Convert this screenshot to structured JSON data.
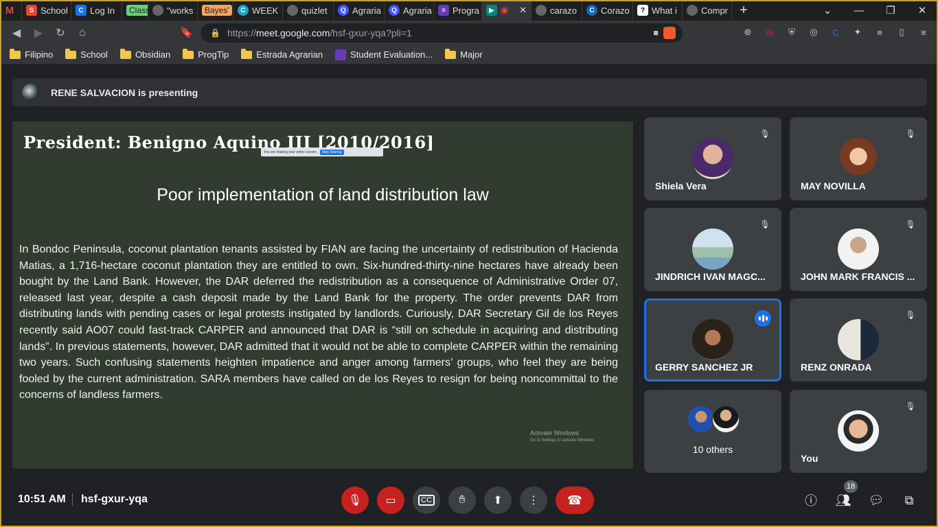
{
  "browser": {
    "tabs": [
      {
        "label": "",
        "icon": "gmail-icon",
        "color": "#d93025"
      },
      {
        "label": "School",
        "icon": "school-icon",
        "color": "#ea4335"
      },
      {
        "label": "Log In",
        "icon": "login-icon",
        "color": "#1a73e8"
      },
      {
        "label": "Class",
        "icon": "class-icon",
        "color": "#6ccf7f"
      },
      {
        "label": "\"works",
        "icon": "globe-icon",
        "color": "#888"
      },
      {
        "label": "Bayes'",
        "icon": "bayes-icon",
        "color": "#f4a460"
      },
      {
        "label": "WEEK",
        "icon": "canva-icon",
        "color": "#1aa3c7"
      },
      {
        "label": "quizlet",
        "icon": "globe-icon",
        "color": "#888"
      },
      {
        "label": "Agraria",
        "icon": "quizlet-icon",
        "color": "#4255ff"
      },
      {
        "label": "Agraria",
        "icon": "quizlet-icon",
        "color": "#4255ff"
      },
      {
        "label": "Progra",
        "icon": "forms-icon",
        "color": "#673ab7"
      },
      {
        "label": "",
        "icon": "meet-icon",
        "color": "#00897b"
      },
      {
        "label": "carazo",
        "icon": "globe-icon",
        "color": "#888"
      },
      {
        "label": "Corazo",
        "icon": "doc-icon",
        "color": "#1565c0"
      },
      {
        "label": "What i",
        "icon": "question-icon",
        "color": "#fff"
      },
      {
        "label": "Compr",
        "icon": "globe-icon",
        "color": "#888"
      }
    ],
    "url_host": "meet.google.com",
    "url_path": "/hsf-gxur-yqa?pli=1",
    "url_prefix": "https://",
    "bookmarks": [
      "Filipino",
      "School",
      "Obsidian",
      "ProgTip",
      "Estrada Agrarian",
      "Student Evaluation...",
      "Major"
    ]
  },
  "meet": {
    "presenter_banner": "RENE SALVACION is presenting",
    "slide": {
      "title": "President: Benigno Aquino III [2010/2016]",
      "sharing_notice": "You are sharing your entire screen.",
      "stop_sharing": "Stop Sharing",
      "subtitle": "Poor implementation of land distribution law",
      "body": "In Bondoc Peninsula, coconut plantation tenants assisted by FIAN are facing the uncertainty of redistribution of Hacienda Matias, a 1,716-hectare coconut plantation they are entitled to own. Six-hundred-thirty-nine hectares have already been bought by the Land Bank. However, the DAR deferred the redistribution as a consequence of Administrative Order 07, released last year, despite a cash deposit made by the Land Bank for the property. The order prevents DAR from distributing lands with pending cases or legal protests instigated by landlords. Curiously, DAR Secretary Gil de los Reyes recently said AO07 could fast-track CARPER and announced that DAR is “still on schedule in acquiring and distributing lands”. In previous statements, however, DAR admitted that it would not be able to complete CARPER within the remaining two years. Such confusing statements heighten impatience and anger among farmers’ groups, who feel they are being fooled by the current administration. SARA members have called on de los Reyes to resign for being noncommittal to the concerns of landless farmers.",
      "watermark_title": "Activate Windows",
      "watermark_sub": "Go to Settings to activate Windows."
    },
    "participants": [
      {
        "name": "Shiela Vera",
        "muted": true
      },
      {
        "name": "MAY NOVILLA",
        "muted": true
      },
      {
        "name": "JINDRICH IVAN MAGC...",
        "muted": true
      },
      {
        "name": "JOHN MARK FRANCIS ...",
        "muted": true
      },
      {
        "name": "GERRY SANCHEZ JR",
        "muted": false,
        "speaking": true
      },
      {
        "name": "RENZ ONRADA",
        "muted": true
      },
      {
        "name": "10 others",
        "muted": false
      },
      {
        "name": "You",
        "muted": true
      }
    ],
    "time": "10:51 AM",
    "meeting_code": "hsf-gxur-yqa",
    "people_count": "18",
    "accent": "#1a73e8",
    "danger": "#c5221f"
  }
}
